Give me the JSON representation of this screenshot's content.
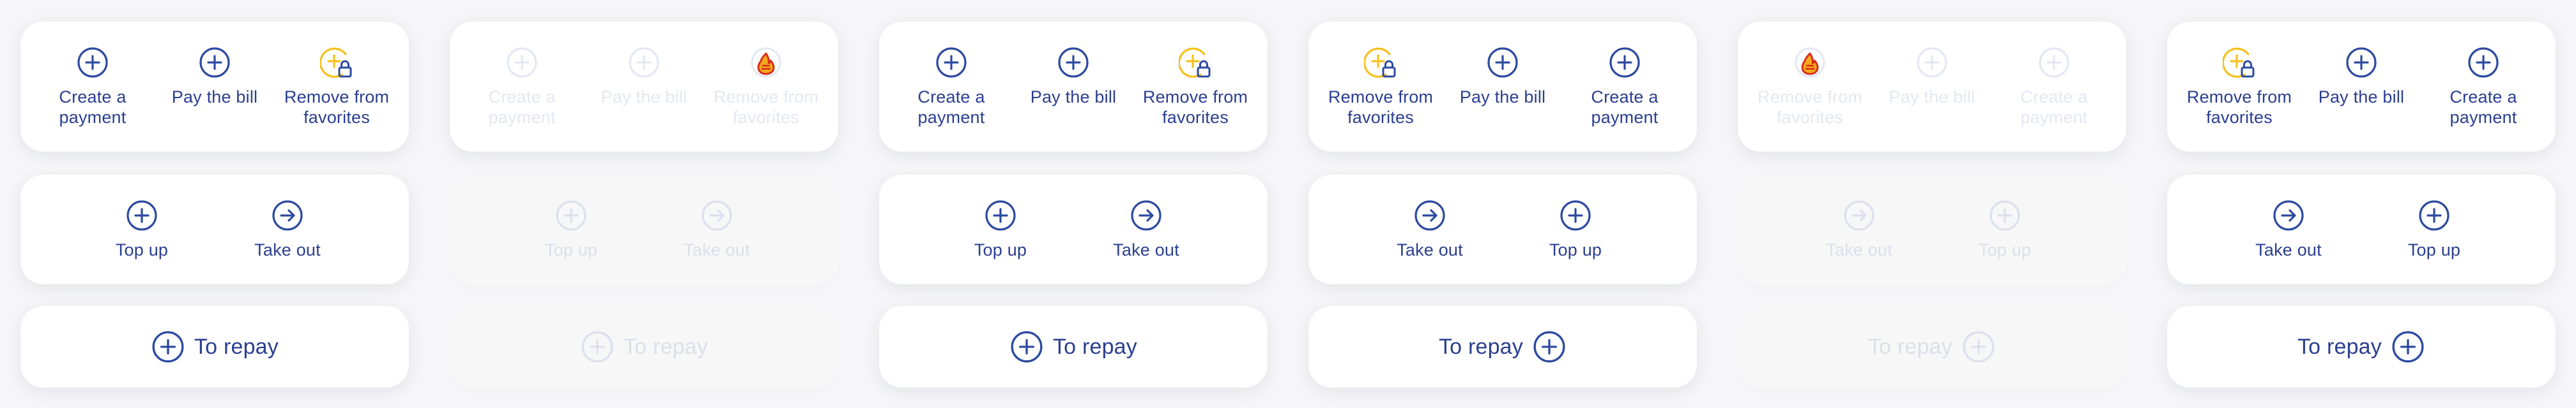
{
  "colors": {
    "primary": "#2d4aa0",
    "accent_yellow": "#f5c11c",
    "background": "#f6f6f8",
    "card": "#ffffff"
  },
  "columns": [
    {
      "state": "normal",
      "row1": [
        {
          "label": "Create a payment",
          "icon": "plus-circle-icon"
        },
        {
          "label": "Pay the bill",
          "icon": "plus-circle-icon"
        },
        {
          "label": "Remove from favorites",
          "icon": "plus-lock-icon"
        }
      ],
      "row2": [
        {
          "label": "Top up",
          "icon": "plus-circle-icon"
        },
        {
          "label": "Take out",
          "icon": "arrow-right-circle-icon"
        }
      ],
      "row3": {
        "label": "To repay",
        "icon": "plus-circle-icon",
        "icon_position": "left"
      }
    },
    {
      "state": "faded",
      "row1": [
        {
          "label": "Create a payment",
          "icon": "plus-circle-icon"
        },
        {
          "label": "Pay the bill",
          "icon": "plus-circle-icon"
        },
        {
          "label": "Remove from favorites",
          "icon": "fire-warning-icon"
        }
      ],
      "row2": [
        {
          "label": "Top up",
          "icon": "plus-circle-icon"
        },
        {
          "label": "Take out",
          "icon": "arrow-right-circle-icon"
        }
      ],
      "row3": {
        "label": "To repay",
        "icon": "plus-circle-icon",
        "icon_position": "left"
      }
    },
    {
      "state": "normal",
      "row1": [
        {
          "label": "Create a payment",
          "icon": "plus-circle-icon"
        },
        {
          "label": "Pay the bill",
          "icon": "plus-circle-icon"
        },
        {
          "label": "Remove from favorites",
          "icon": "plus-lock-icon"
        }
      ],
      "row2": [
        {
          "label": "Top up",
          "icon": "plus-circle-icon"
        },
        {
          "label": "Take out",
          "icon": "arrow-right-circle-icon"
        }
      ],
      "row3": {
        "label": "To repay",
        "icon": "plus-circle-icon",
        "icon_position": "left"
      }
    },
    {
      "state": "normal",
      "row1": [
        {
          "label": "Remove from favorites",
          "icon": "plus-lock-icon"
        },
        {
          "label": "Pay the bill",
          "icon": "plus-circle-icon"
        },
        {
          "label": "Create a payment",
          "icon": "plus-circle-icon"
        }
      ],
      "row2": [
        {
          "label": "Take out",
          "icon": "arrow-right-circle-icon"
        },
        {
          "label": "Top up",
          "icon": "plus-circle-icon"
        }
      ],
      "row3": {
        "label": "To repay",
        "icon": "plus-circle-icon",
        "icon_position": "right"
      }
    },
    {
      "state": "faded",
      "row1": [
        {
          "label": "Remove from favorites",
          "icon": "fire-warning-icon"
        },
        {
          "label": "Pay the bill",
          "icon": "plus-circle-icon"
        },
        {
          "label": "Create a payment",
          "icon": "plus-circle-icon"
        }
      ],
      "row2": [
        {
          "label": "Take out",
          "icon": "arrow-right-circle-icon"
        },
        {
          "label": "Top up",
          "icon": "plus-circle-icon"
        }
      ],
      "row3": {
        "label": "To repay",
        "icon": "plus-circle-icon",
        "icon_position": "right"
      }
    },
    {
      "state": "normal",
      "row1": [
        {
          "label": "Remove from favorites",
          "icon": "plus-lock-icon"
        },
        {
          "label": "Pay the bill",
          "icon": "plus-circle-icon"
        },
        {
          "label": "Create a payment",
          "icon": "plus-circle-icon"
        }
      ],
      "row2": [
        {
          "label": "Take out",
          "icon": "arrow-right-circle-icon"
        },
        {
          "label": "Top up",
          "icon": "plus-circle-icon"
        }
      ],
      "row3": {
        "label": "To repay",
        "icon": "plus-circle-icon",
        "icon_position": "right"
      }
    }
  ]
}
